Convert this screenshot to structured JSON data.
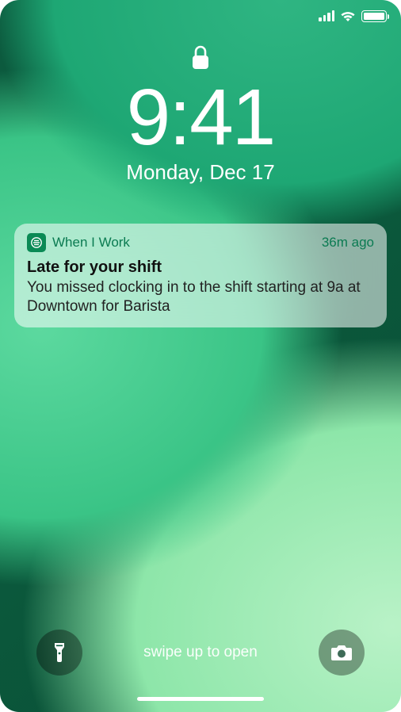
{
  "status": {
    "signal_bars": 4,
    "wifi": true,
    "battery_pct": 100
  },
  "lock": {
    "locked": true
  },
  "clock": {
    "time": "9:41",
    "date": "Monday, Dec 17"
  },
  "notification": {
    "app_name": "When I Work",
    "age": "36m ago",
    "title": "Late for your shift",
    "body": "You missed clocking in to the shift starting at 9a at Downtown for Barista"
  },
  "bottom": {
    "swipe_hint": "swipe up to open"
  },
  "colors": {
    "accent": "#0b7b52"
  }
}
